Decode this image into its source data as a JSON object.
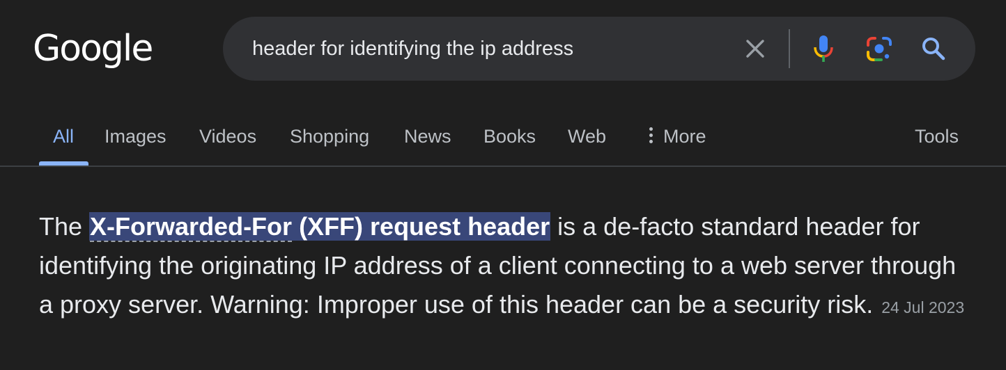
{
  "logo": {
    "text": "Google"
  },
  "search": {
    "query": "header for identifying the ip address",
    "icons": {
      "clear": "close-icon",
      "voice": "microphone-icon",
      "lens": "camera-lens-icon",
      "search": "search-icon"
    }
  },
  "tabs": [
    {
      "label": "All",
      "active": true
    },
    {
      "label": "Images"
    },
    {
      "label": "Videos"
    },
    {
      "label": "Shopping"
    },
    {
      "label": "News"
    },
    {
      "label": "Books"
    },
    {
      "label": "Web"
    },
    {
      "label": "More",
      "icon": "more-vert-icon"
    }
  ],
  "tools": {
    "label": "Tools"
  },
  "result": {
    "prefix": "The ",
    "linked": "X-Forwarded-For",
    "highlight_rest": " (XFF) request header",
    "body": " is a de-facto standard header for identifying the originating IP address of a client connecting to a web server through a proxy server. Warning: Improper use of this header can be a security risk.",
    "date": "24 Jul 2023"
  },
  "colors": {
    "background": "#1f1f1f",
    "search_box": "#303134",
    "accent": "#8ab4f8",
    "highlight": "#394779",
    "tab_text": "#bdc1c6"
  }
}
